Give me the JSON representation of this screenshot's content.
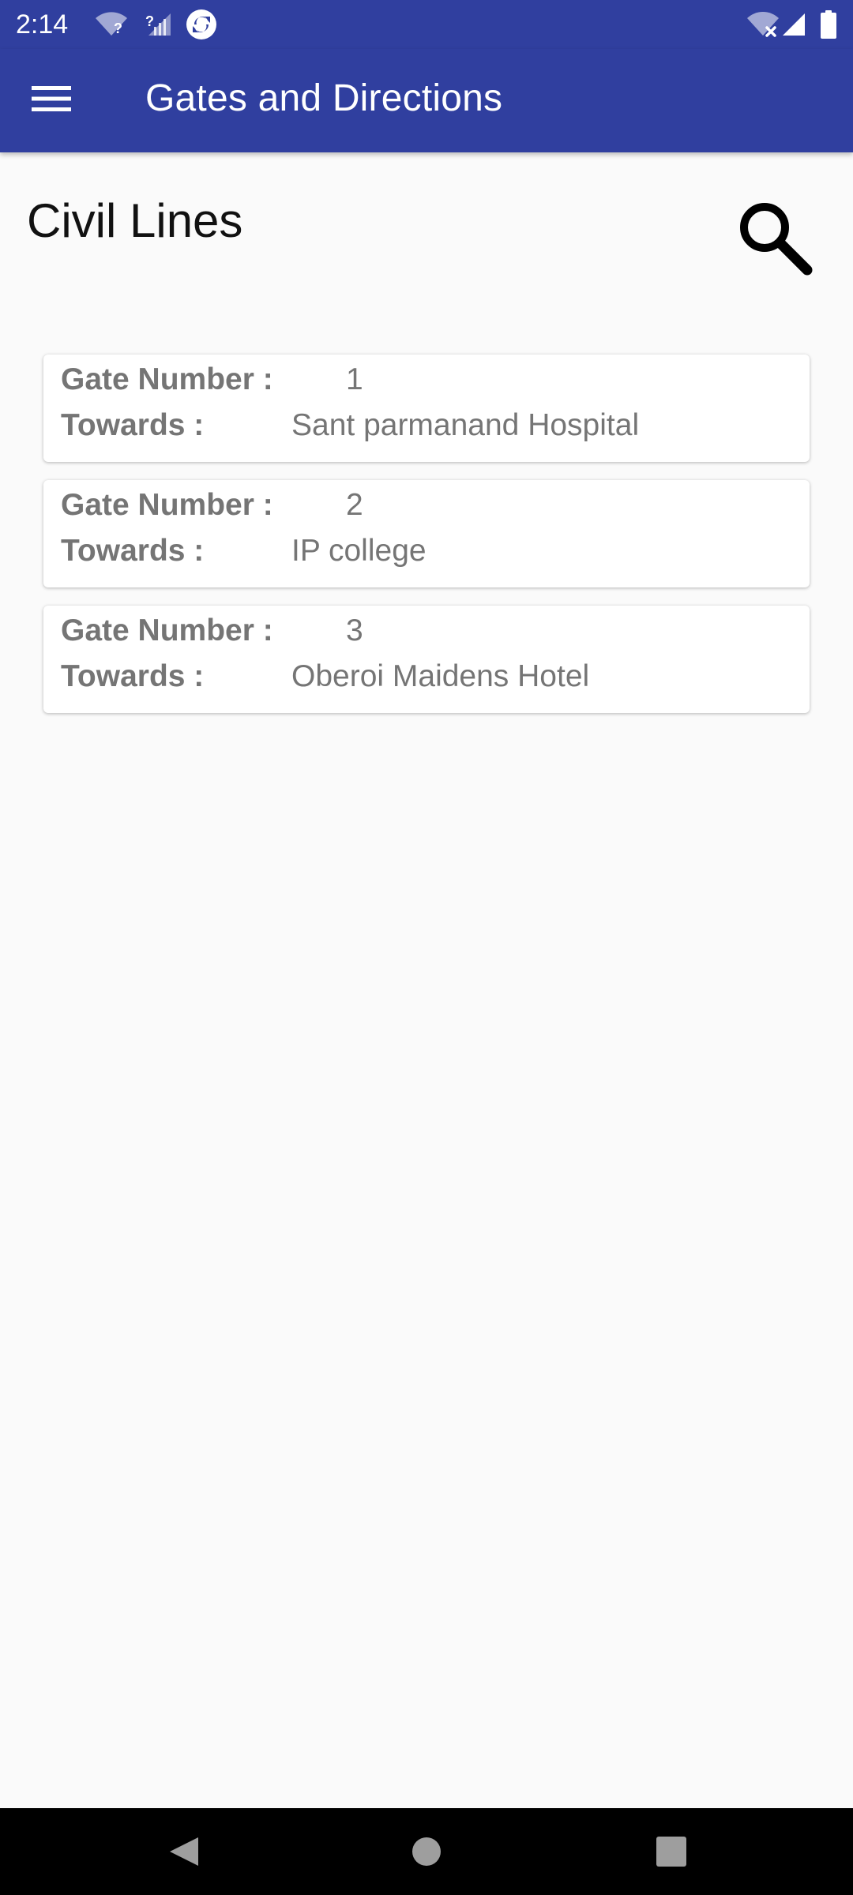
{
  "status_bar": {
    "time": "2:14",
    "icons": [
      "wifi-unknown-icon",
      "signal-unknown-icon",
      "sync-app-icon",
      "wifi-off-icon",
      "cell-signal-icon",
      "battery-icon"
    ]
  },
  "app_bar": {
    "title": "Gates and Directions",
    "menu_icon": "hamburger-menu-icon"
  },
  "station": {
    "name": "Civil Lines",
    "search_icon": "search-icon"
  },
  "gate_labels": {
    "gate_number": "Gate Number :",
    "towards": "Towards :"
  },
  "gates": [
    {
      "number": "1",
      "towards": "Sant parmanand Hospital"
    },
    {
      "number": "2",
      "towards": "IP college"
    },
    {
      "number": "3",
      "towards": "Oberoi Maidens Hotel"
    }
  ],
  "nav_bar": {
    "back_icon": "back-triangle-icon",
    "home_icon": "home-circle-icon",
    "recents_icon": "recents-square-icon"
  },
  "colors": {
    "primary": "#303f9f",
    "background": "#fafafa",
    "card_text": "#757575"
  }
}
